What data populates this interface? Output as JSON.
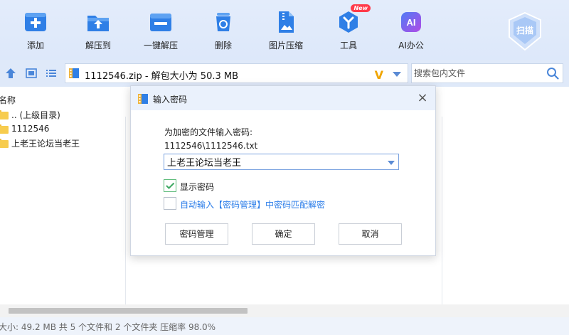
{
  "toolbar": {
    "items": [
      {
        "label": "添加",
        "icon": "add-icon"
      },
      {
        "label": "解压到",
        "icon": "extract-to-icon"
      },
      {
        "label": "一键解压",
        "icon": "one-click-extract-icon"
      },
      {
        "label": "删除",
        "icon": "delete-icon"
      },
      {
        "label": "图片压缩",
        "icon": "image-compress-icon"
      },
      {
        "label": "工具",
        "icon": "tools-icon",
        "badge": "New"
      },
      {
        "label": "AI办公",
        "icon": "ai-office-icon",
        "glyph": "AI"
      }
    ],
    "scan_label": "扫描"
  },
  "address": {
    "path_text": "1112546.zip - 解包大小为 50.3 MB",
    "logo_glyph": "V",
    "search_placeholder": "搜索包内文件"
  },
  "filelist": {
    "column_name": "名称",
    "rows": [
      {
        "name": ".. (上级目录)"
      },
      {
        "name": "1112546"
      },
      {
        "name": "上老王论坛当老王"
      }
    ]
  },
  "status": {
    "text": "大小: 49.2 MB 共 5 个文件和 2 个文件夹 压缩率 98.0%"
  },
  "dialog": {
    "title": "输入密码",
    "close_glyph": "×",
    "prompt": "为加密的文件输入密码:",
    "filename": "1112546\\1112546.txt",
    "password_value": "上老王论坛当老王",
    "show_password_label": "显示密码",
    "show_password_checked": true,
    "auto_input_label": "自动输入【密码管理】中密码匹配解密",
    "auto_input_checked": false,
    "buttons": {
      "manage": "密码管理",
      "ok": "确定",
      "cancel": "取消"
    }
  },
  "colors": {
    "accent": "#2b7de9",
    "link": "#2b7de9",
    "check": "#3aa860"
  }
}
